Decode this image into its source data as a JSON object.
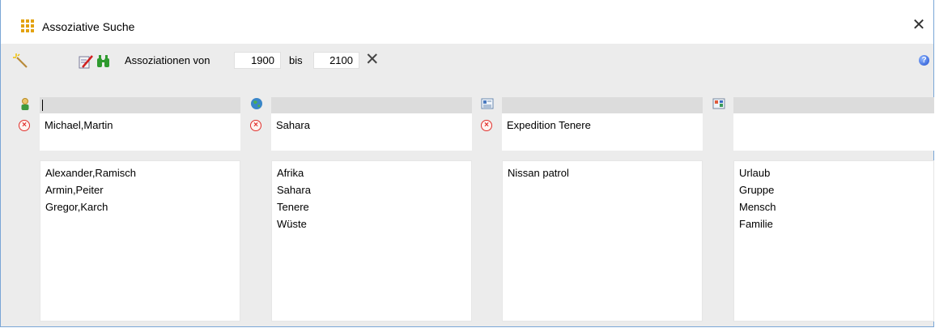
{
  "window": {
    "title": "Assoziative Suche",
    "close_glyph": "✕"
  },
  "toolbar": {
    "wand_icon": "magic-wand-icon",
    "edit_icon": "edit-document-icon",
    "search_icon": "binoculars-icon",
    "range_label": "Assoziationen von",
    "from_value": "1900",
    "to_label": "bis",
    "to_value": "2100",
    "clear_glyph": "✕",
    "help_glyph": "?"
  },
  "columns": [
    {
      "icon": "person-icon",
      "header_value": "",
      "selected": "Michael,Martin",
      "has_remove": true,
      "results": [
        "Alexander,Ramisch",
        "Armin,Peiter",
        "Gregor,Karch"
      ]
    },
    {
      "icon": "globe-icon",
      "header_value": "",
      "selected": "Sahara",
      "has_remove": true,
      "results": [
        "Afrika",
        "Sahara",
        "Tenere",
        "Wüste"
      ]
    },
    {
      "icon": "document-icon",
      "header_value": "",
      "selected": "Expedition Tenere",
      "has_remove": true,
      "results": [
        "Nissan patrol"
      ]
    },
    {
      "icon": "picture-icon",
      "header_value": "",
      "selected": "",
      "has_remove": false,
      "results": [
        "Urlaub",
        "Gruppe",
        "Mensch",
        "Familie"
      ]
    }
  ],
  "colors": {
    "accent_border": "#7aa6d6",
    "remove_red": "#e0302c",
    "header_gray": "#dcdcdc"
  }
}
